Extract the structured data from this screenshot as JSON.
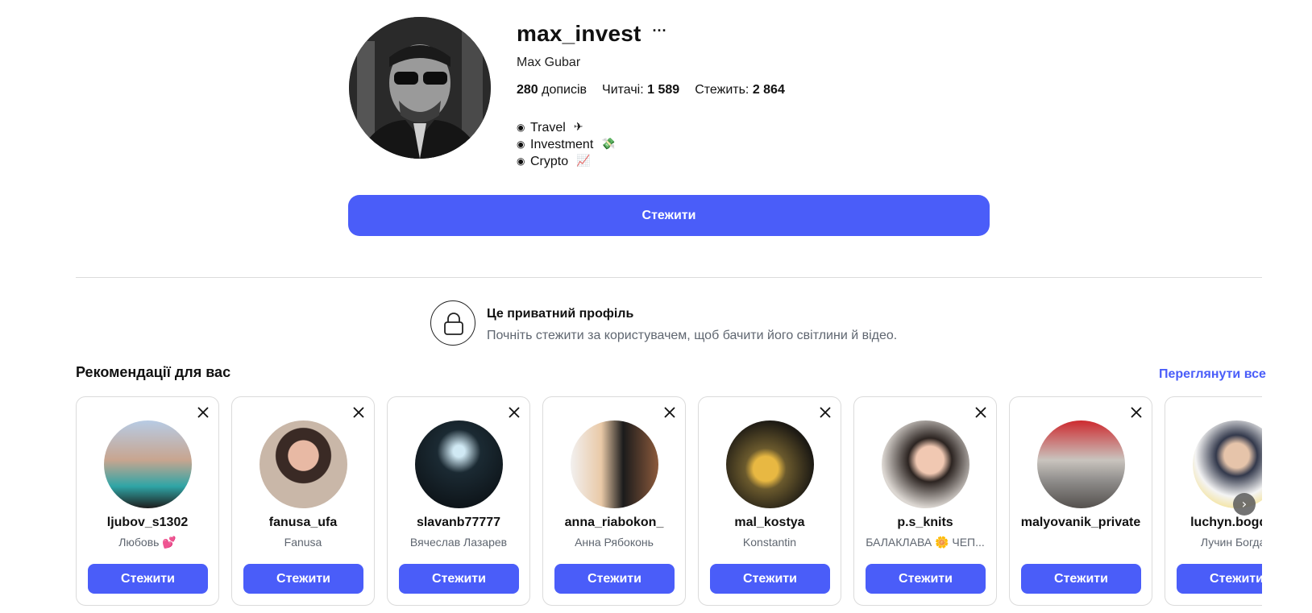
{
  "profile": {
    "username": "max_invest",
    "more_icon": "···",
    "full_name": "Max Gubar",
    "stats": {
      "posts_count": "280",
      "posts_label": "дописів",
      "followers_label": "Читачі:",
      "followers_count": "1 589",
      "following_label": "Стежить:",
      "following_count": "2 864"
    },
    "bio": [
      {
        "bullet": "◉",
        "text": "Travel",
        "emoji": "✈"
      },
      {
        "bullet": "◉",
        "text": "Investment",
        "emoji": "💸"
      },
      {
        "bullet": "◉",
        "text": "Crypto",
        "emoji": "📈"
      }
    ],
    "follow_label": "Стежити"
  },
  "private_notice": {
    "icon": "lock-icon",
    "title": "Це приватний профіль",
    "subtitle": "Почніть стежити за користувачем, щоб бачити його світлини й відео."
  },
  "recommendations": {
    "title": "Рекомендації для вас",
    "see_all": "Переглянути все",
    "next_arrow": "›",
    "accent_color": "#4a5df9",
    "cards": [
      {
        "username": "ljubov_s1302",
        "name": "Любовь 💕",
        "button": "Стежити"
      },
      {
        "username": "fanusa_ufa",
        "name": "Fanusa",
        "button": "Стежити"
      },
      {
        "username": "slavanb77777",
        "name": "Вячеслав Лазарев",
        "button": "Стежити"
      },
      {
        "username": "anna_riabokon_",
        "name": "Анна Рябоконь",
        "button": "Стежити"
      },
      {
        "username": "mal_kostya",
        "name": "Konstantin",
        "button": "Стежити"
      },
      {
        "username": "p.s_knits",
        "name": "БАЛАКЛАВА 🌼 ЧЕП...",
        "button": "Стежити"
      },
      {
        "username": "malyovanik_private",
        "name": "",
        "button": "Стежити"
      },
      {
        "username": "luchyn.bogdan",
        "name": "Лучин Богдан",
        "button": "Стежити"
      }
    ]
  }
}
